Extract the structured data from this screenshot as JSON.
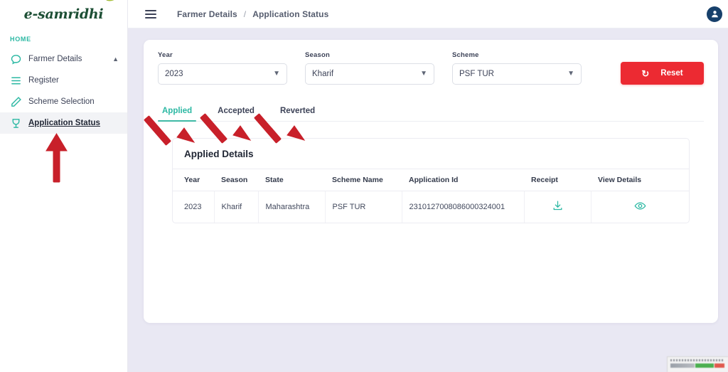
{
  "brand": {
    "logo_text": "e-samridhi",
    "leaf_color": "#a8c03c",
    "logo_color": "#1d4f35"
  },
  "theme": {
    "accent_teal": "#2bb8a3",
    "danger_red": "#ec2a32",
    "page_bg": "#e9e8f3",
    "annotation_red": "#c8202a"
  },
  "sidebar": {
    "section_label": "HOME",
    "items": [
      {
        "label": "Farmer Details",
        "icon": "speech-bubble-icon",
        "active": false,
        "chevron": "chevron-up-icon"
      },
      {
        "label": "Register",
        "icon": "list-icon",
        "active": false
      },
      {
        "label": "Scheme Selection",
        "icon": "pencil-icon",
        "active": false
      },
      {
        "label": "Application Status",
        "icon": "trophy-icon",
        "active": true
      }
    ]
  },
  "topbar": {
    "menu_icon": "hamburger-icon",
    "breadcrumb": {
      "parent": "Farmer Details",
      "separator": "/",
      "current": "Application Status"
    },
    "avatar_icon": "user-avatar-icon"
  },
  "filters": {
    "year": {
      "label": "Year",
      "value": "2023"
    },
    "season": {
      "label": "Season",
      "value": "Kharif"
    },
    "scheme": {
      "label": "Scheme",
      "value": "PSF TUR"
    },
    "reset": {
      "label": "Reset",
      "icon": "refresh-icon"
    }
  },
  "tabs": [
    {
      "label": "Applied",
      "active": true
    },
    {
      "label": "Accepted",
      "active": false
    },
    {
      "label": "Reverted",
      "active": false
    }
  ],
  "table": {
    "title": "Applied Details",
    "columns": [
      "Year",
      "Season",
      "State",
      "Scheme Name",
      "Application Id",
      "Receipt",
      "View Details"
    ],
    "rows": [
      {
        "year": "2023",
        "season": "Kharif",
        "state": "Maharashtra",
        "scheme_name": "PSF TUR",
        "application_id": "2310127008086000324001",
        "receipt_icon": "download-icon",
        "view_details_icon": "eye-icon"
      }
    ]
  },
  "annotations": {
    "arrow_sidebar": "up-arrow-pointing-to-application-status",
    "arrow_applied": "arrow-pointing-to-applied-tab",
    "arrow_accepted": "arrow-pointing-to-accepted-tab",
    "arrow_reverted": "arrow-pointing-to-reverted-tab"
  }
}
